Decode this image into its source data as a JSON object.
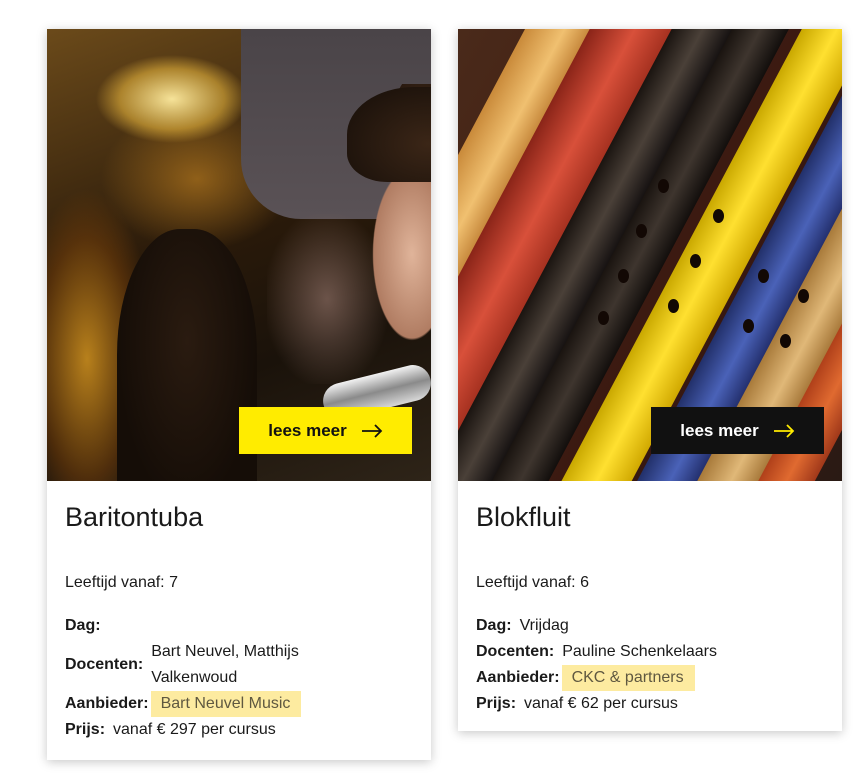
{
  "courses": [
    {
      "title": "Baritontuba",
      "button_label": "lees meer",
      "age": "Leeftijd vanaf: 7",
      "day_label": "Dag:",
      "day_value": "",
      "teachers_label": "Docenten:",
      "teachers_value_line1": "Bart Neuvel, Matthijs",
      "teachers_value_line2": "Valkenwoud",
      "provider_label": "Aanbieder:",
      "provider_value": "Bart Neuvel Music",
      "price_label": "Prijs:",
      "price_value": "vanaf € 297 per cursus",
      "image_icon": "tuba-photo",
      "button_color": "#ffec00"
    },
    {
      "title": "Blokfluit",
      "button_label": "lees meer",
      "age": "Leeftijd vanaf: 6",
      "day_label": "Dag:",
      "day_value": "Vrijdag",
      "teachers_label": "Docenten:",
      "teachers_value": "Pauline Schenkelaars",
      "provider_label": "Aanbieder:",
      "provider_value": "CKC & partners",
      "price_label": "Prijs:",
      "price_value": "vanaf € 62 per cursus",
      "image_icon": "recorder-photo",
      "button_color": "#111111"
    }
  ],
  "colors": {
    "highlight_bg": "#fdeba0",
    "accent_yellow": "#ffec00",
    "dark": "#111111"
  },
  "icons": {
    "arrow": "arrow-right-icon"
  }
}
